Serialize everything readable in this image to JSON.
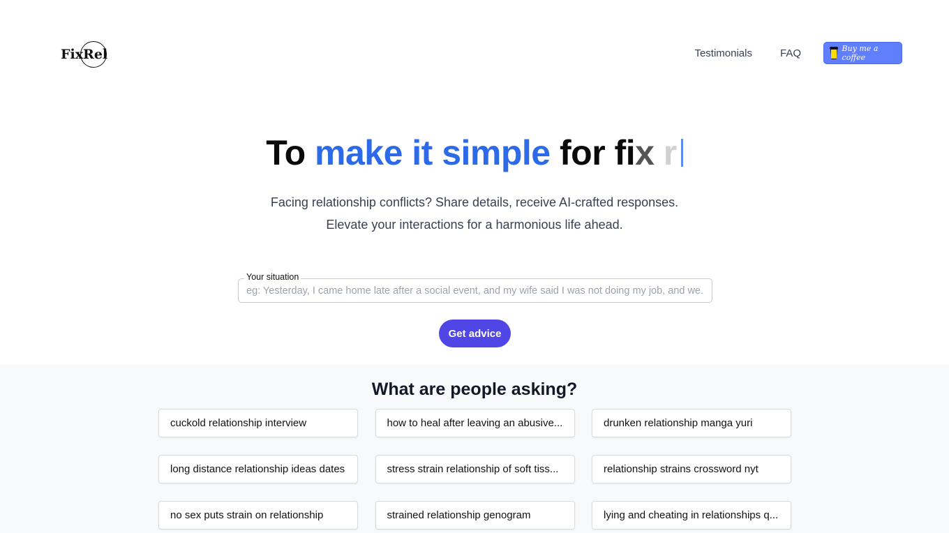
{
  "header": {
    "logo": "FixRel",
    "nav": [
      {
        "label": "Testimonials"
      },
      {
        "label": "FAQ"
      }
    ],
    "coffee_label": "Buy me a coffee",
    "coffee_color": "#5f7fff"
  },
  "hero": {
    "title_parts": [
      "To ",
      "make it simple",
      " for fi",
      "x",
      " r"
    ],
    "accent": "#2d6ae8",
    "subtitle_line1": "Facing relationship conflicts? Share details, receive AI-crafted responses.",
    "subtitle_line2": "Elevate your interactions for a harmonious life ahead."
  },
  "form": {
    "label": "Your situation",
    "placeholder": "eg: Yesterday, I came home late after a social event, and my wife said I was not doing my job, and we...",
    "button": "Get advice",
    "button_color": "#4f46e5"
  },
  "asking": {
    "title": "What are people asking?",
    "items": [
      "cuckold relationship interview",
      "how to heal after leaving an abusive...",
      "drunken relationship manga yuri",
      "long distance relationship ideas dates",
      "stress strain relationship of soft tiss...",
      "relationship strains crossword nyt",
      "no sex puts strain on relationship",
      "strained relationship genogram",
      "lying and cheating in relationships q..."
    ]
  }
}
